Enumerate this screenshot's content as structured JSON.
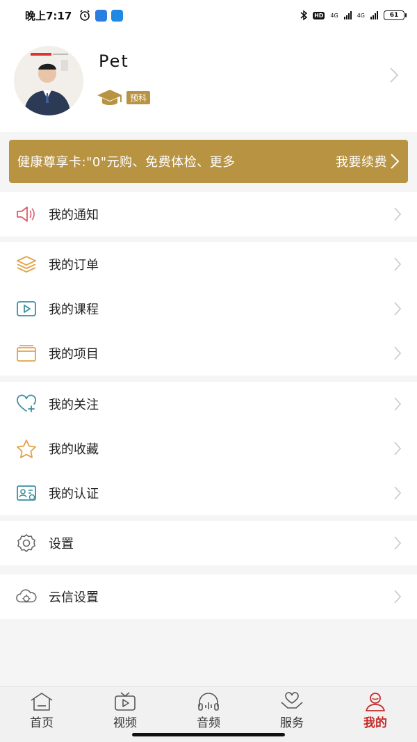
{
  "status_bar": {
    "time": "晚上7:17",
    "hd": "HD",
    "net1": "4G",
    "net2": "4G",
    "battery": "61"
  },
  "profile": {
    "username": "Pet",
    "level_badge": "预科"
  },
  "vip_banner": {
    "text": "健康尊享卡:\"0\"元购、免费体检、更多",
    "action": "我要续费"
  },
  "menu_groups": [
    {
      "items": [
        {
          "label": "我的通知",
          "icon": "speaker-icon"
        }
      ]
    },
    {
      "items": [
        {
          "label": "我的订单",
          "icon": "layers-icon"
        },
        {
          "label": "我的课程",
          "icon": "video-play-icon"
        },
        {
          "label": "我的项目",
          "icon": "folder-icon"
        }
      ]
    },
    {
      "items": [
        {
          "label": "我的关注",
          "icon": "heart-plus-icon"
        },
        {
          "label": "我的收藏",
          "icon": "star-icon"
        },
        {
          "label": "我的认证",
          "icon": "id-card-icon"
        }
      ]
    },
    {
      "items": [
        {
          "label": "设置",
          "icon": "gear-icon"
        }
      ]
    },
    {
      "items": [
        {
          "label": "云信设置",
          "icon": "cloud-gear-icon"
        }
      ]
    }
  ],
  "tabbar": {
    "tabs": [
      {
        "label": "首页",
        "icon": "home-icon"
      },
      {
        "label": "视频",
        "icon": "tv-icon"
      },
      {
        "label": "音频",
        "icon": "headphones-icon"
      },
      {
        "label": "服务",
        "icon": "heart-hands-icon"
      },
      {
        "label": "我的",
        "icon": "user-icon",
        "active": true
      }
    ]
  },
  "colors": {
    "gold": "#b89342",
    "active_tab": "#c62828",
    "icon_red": "#e05a66",
    "icon_orange": "#e2a24a",
    "icon_teal": "#3a8fa0",
    "icon_gray": "#666666"
  }
}
